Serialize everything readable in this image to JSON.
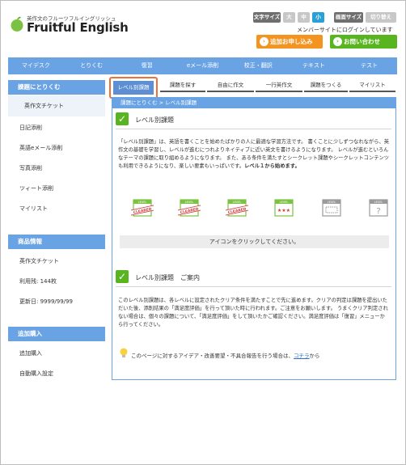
{
  "header": {
    "tagline": "英作文のフルーツフルイングリッシュ",
    "brand": "Fruitful English",
    "text_size_label": "文字サイズ",
    "size_options": [
      "大",
      "中",
      "小"
    ],
    "screen_size_label": "画面サイズ",
    "print_label": "切り替え",
    "member_note": "メンバーサイトにログインしています",
    "apply_button": "追加お申し込み",
    "contact_button": "お問い合わせ",
    "accent_orange": "#f39320",
    "accent_green": "#58b520"
  },
  "nav": {
    "items": [
      "マイデスク",
      "とりくむ",
      "復習",
      "eメール添削",
      "校正・翻訳",
      "テキスト",
      "テスト"
    ],
    "color": "#6aa3e4"
  },
  "sidebar": {
    "section1_title": "課題にとりくむ",
    "section1_items": [
      "英作文チケット",
      "日記添削",
      "英語eメール添削",
      "写真添削",
      "ツィート添削",
      "マイリスト"
    ],
    "section2_title": "商品情報",
    "section2_items": [
      "英作文チケット",
      "利用残: 144枚",
      "更新日: 9999/99/99"
    ],
    "section3_title": "追加購入",
    "section3_items": [
      "追加購入",
      "自動購入設定"
    ]
  },
  "tabs": [
    "レベル別課題",
    "課題を探す",
    "自由に作文",
    "一行英作文",
    "課題をつくる",
    "マイリスト"
  ],
  "main": {
    "breadcrumb": "課題にとりくむ > レベル別課題",
    "section1_title": "レベル別課題",
    "intro_text": "「レベル別課題」は、英語を書くことを始めたばかりの人に最適な学習方法です。 書くことに少しずつなれながら、英作文の基礎を学習し、レベルが進むにつれよりネイティブに近い英文を書けるようになります。 レベルが進むといろんなテーマの課題に取り組めるようになります。 また、ある条件を満たすとシークレット課題やシークレットコンテンツも利用できるようになり、楽しい要素もいっぱいです。",
    "intro_bold": "レベル１から始めます。",
    "badges": [
      {
        "label": "LEVEL",
        "status": "CLEARED"
      },
      {
        "label": "LEVEL",
        "status": "CLEARED"
      },
      {
        "label": "LEVEL",
        "status": "CLEARED"
      },
      {
        "label": "LEVEL",
        "status": "current"
      },
      {
        "label": "LEVEL",
        "status": "locked"
      },
      {
        "label": "LEVEL",
        "status": "unknown"
      }
    ],
    "icon_hint": "アイコンをクリックしてください。",
    "section2_title": "レベル別課題　ご案内",
    "guide_text": "このレベル別課題は、各レベルに設定されたクリア条件を満たすことで先に進めます。クリアの判定は課題を提出いただいた後、添削結果の「満足度評価」を行って頂いた時に行われます。ご注意をお願いします。 うまくクリア判定されない場合は、個々の課題について、「満足度評価」をして頂いたかご確認ください。満足度評価は「復習」メニューから行ってください。",
    "footnote_text": "このページに対するアイデア・改善要望・不具合報告を行う場合は、",
    "footnote_link": "コチラ",
    "footnote_tail": "から"
  }
}
